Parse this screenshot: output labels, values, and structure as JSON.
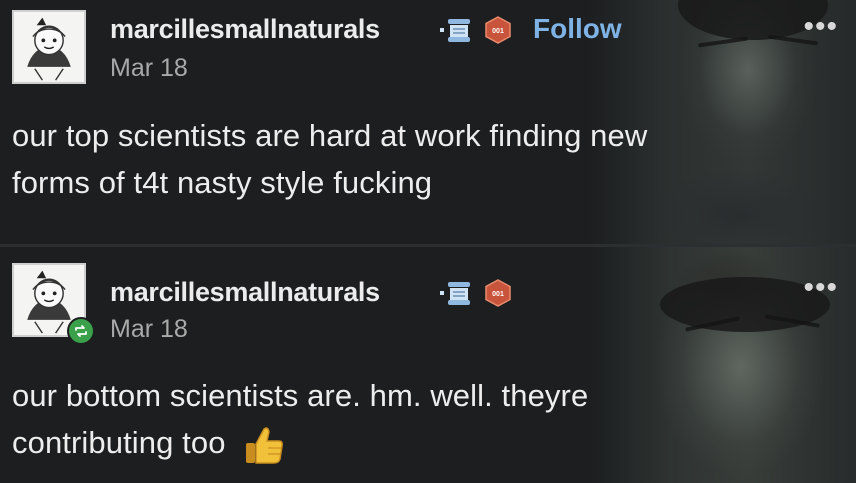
{
  "posts": [
    {
      "username": "marcillesmallnaturals",
      "date": "Mar 18",
      "follow_label": "Follow",
      "more_label": "•••",
      "text_lines": [
        "our top scientists are hard at work finding new",
        "forms of t4t nasty style fucking"
      ],
      "icons": [
        "avatar-icon",
        "scroll-badge-icon",
        "hex-badge-icon",
        "more-icon"
      ]
    },
    {
      "username": "marcillesmallnaturals",
      "date": "Mar 18",
      "more_label": "•••",
      "text_lines": [
        "our bottom scientists are. hm. well. theyre",
        "contributing too"
      ],
      "emoji": "thumbs-up-icon",
      "icons": [
        "avatar-icon",
        "reblog-icon",
        "scroll-badge-icon",
        "hex-badge-icon",
        "more-icon"
      ]
    }
  ],
  "colors": {
    "background": "#1c1e1f",
    "text": "#ededed",
    "date": "#a9a9a9",
    "follow": "#7fb3e6",
    "reblog_badge": "#3aa14a",
    "hex_badge": "#c8543c"
  }
}
